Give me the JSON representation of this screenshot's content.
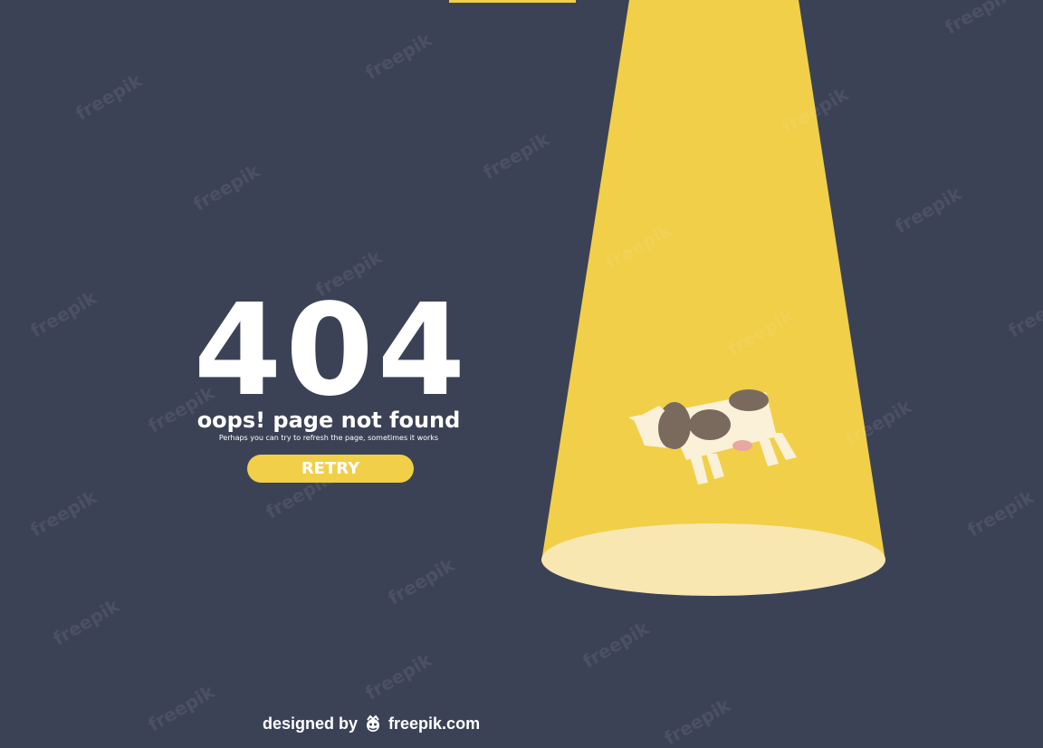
{
  "error": {
    "code": "404",
    "headline": "oops! page not found",
    "message": "Perhaps you can try to refresh the page, sometimes it works"
  },
  "actions": {
    "retry_label": "RETRY"
  },
  "credit": {
    "prefix": "designed by",
    "brand": "freepik.com",
    "logo_icon": "freepik-logo-icon"
  },
  "watermark": {
    "text": "freepik"
  },
  "colors": {
    "background": "#3c4256",
    "accent": "#f1cf48",
    "beam": "#f1cf48",
    "spot": "#f8e7b0",
    "text": "#ffffff"
  }
}
